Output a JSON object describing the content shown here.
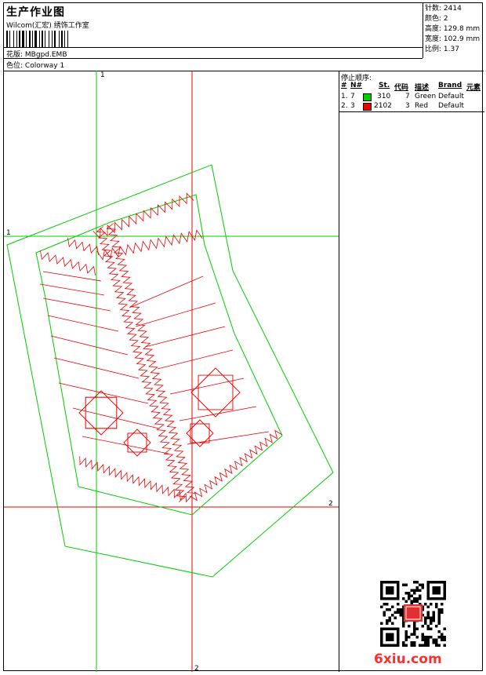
{
  "header": {
    "title": "生产作业图",
    "subtitle": "Wilcom(汇宏) 绣饰工作室",
    "design_label": "花版:",
    "design_file": "MBgpd.EMB",
    "colorway_label": "色位:",
    "colorway": "Colorway 1"
  },
  "stats": [
    {
      "label": "针数:",
      "value": "2414"
    },
    {
      "label": "颜色:",
      "value": "2"
    },
    {
      "label": "高度:",
      "value": "129.8 mm"
    },
    {
      "label": "宽度:",
      "value": "102.9 mm"
    },
    {
      "label": "比例:",
      "value": "1.37"
    }
  ],
  "stop_sequence": {
    "title": "停止顺序:",
    "columns": [
      "#",
      "N#",
      "St.",
      "代码",
      "描述",
      "Brand",
      "元素"
    ],
    "rows": [
      {
        "index": "1.",
        "needle": "7",
        "color": "#00cc00",
        "stitches": "310",
        "code": "7",
        "desc": "Green",
        "brand": "Default"
      },
      {
        "index": "2.",
        "needle": "3",
        "color": "#ee0000",
        "stitches": "2102",
        "code": "3",
        "desc": "Red",
        "brand": "Default"
      }
    ]
  },
  "guides": {
    "v1": "1",
    "h1": "1",
    "h2": "2",
    "v2": "2"
  },
  "colors": {
    "green": "#00cc00",
    "red": "#ee0000"
  },
  "watermark": {
    "site": "6xiu.com"
  }
}
